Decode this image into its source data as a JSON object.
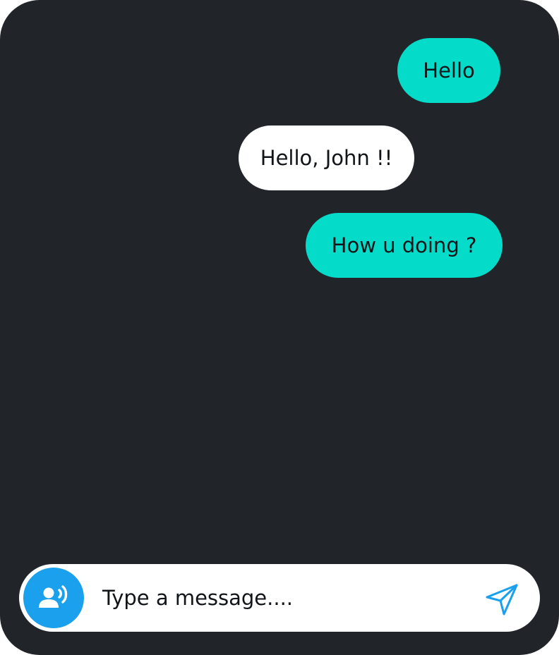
{
  "colors": {
    "background": "#212429",
    "sent_bubble": "#04dbc8",
    "received_bubble": "#ffffff",
    "accent": "#1aa0ec",
    "text": "#111418"
  },
  "messages": [
    {
      "text": "Hello",
      "direction": "sent"
    },
    {
      "text": "Hello, John !!",
      "direction": "received"
    },
    {
      "text": "How u doing ?",
      "direction": "sent"
    }
  ],
  "composer": {
    "placeholder": "Type a message....",
    "voice_icon": "voice-user-icon",
    "send_icon": "send-icon"
  }
}
